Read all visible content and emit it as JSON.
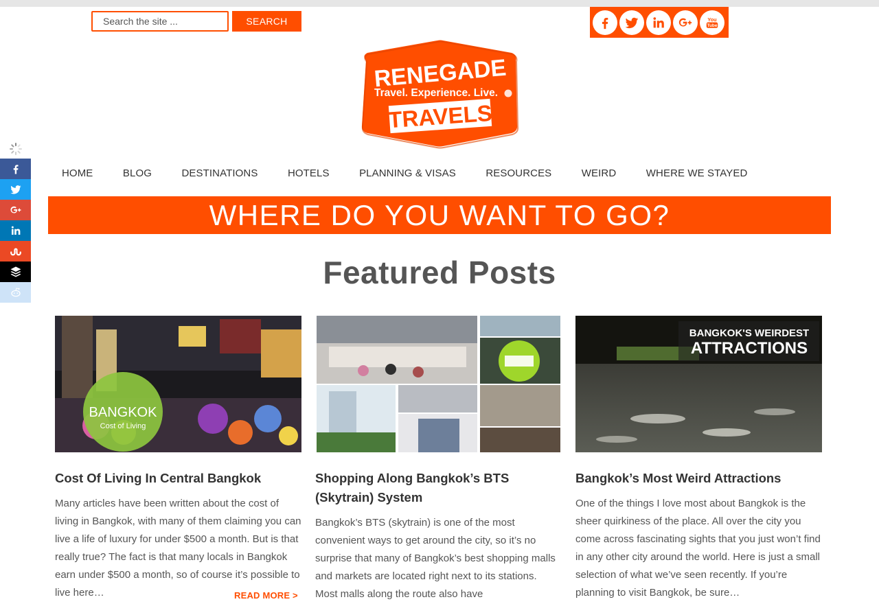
{
  "search": {
    "placeholder": "Search the site ...",
    "button_label": "SEARCH"
  },
  "social_top": {
    "icons": [
      "facebook-icon",
      "twitter-icon",
      "linkedin-icon",
      "google-plus-icon",
      "youtube-icon"
    ]
  },
  "logo": {
    "line1": "RENEGADE",
    "line2": "Travel. Experience. Live.",
    "line3": "TRAVELS"
  },
  "nav": {
    "items": [
      {
        "label": "HOME"
      },
      {
        "label": "BLOG"
      },
      {
        "label": "DESTINATIONS"
      },
      {
        "label": "HOTELS"
      },
      {
        "label": "PLANNING & VISAS"
      },
      {
        "label": "RESOURCES"
      },
      {
        "label": "WEIRD"
      },
      {
        "label": "WHERE WE STAYED"
      }
    ]
  },
  "banner": {
    "text": "WHERE DO YOU WANT TO GO?"
  },
  "featured": {
    "heading": "Featured Posts"
  },
  "share_bar": {
    "items": [
      "facebook-icon",
      "twitter-icon",
      "google-plus-icon",
      "linkedin-icon",
      "stumbleupon-icon",
      "buffer-icon",
      "reddit-icon"
    ]
  },
  "colors": {
    "accent": "#ff4e00",
    "facebook": "#3b5998",
    "twitter": "#1da1f2",
    "google_plus": "#dd4b39",
    "linkedin": "#0077b5",
    "stumbleupon": "#eb4924",
    "buffer": "#000000",
    "reddit": "#cee3f8"
  },
  "posts": [
    {
      "title": "Cost Of Living In Central Bangkok",
      "image_text_1": "BANGKOK",
      "image_text_2": "Cost of Living",
      "excerpt": "Many articles have been written about the cost of living in Bangkok, with many of them claiming you can live a life of luxury for under $500 a month. But is that really true? The fact is that many locals in Bangkok earn under $500 a month, so of course it’s possible to live here…",
      "read_more": "READ MORE >"
    },
    {
      "title": "Shopping Along Bangkok’s BTS (Skytrain) System",
      "excerpt": "Bangkok’s BTS (skytrain) is one of the most convenient ways to get around the city, so it’s no surprise that many of Bangkok’s best shopping malls and markets are located right next to its stations. Most malls along the route also have"
    },
    {
      "title": "Bangkok’s Most Weird Attractions",
      "image_text_1": "BANGKOK'S WEIRDEST",
      "image_text_2": "ATTRACTIONS",
      "excerpt": "One of the things I love most about Bangkok is the sheer quirkiness of the place. All over the city you come across fascinating sights that you just won’t find in any other city around the world. Here is just a small selection of what we’ve seen recently. If you’re planning to visit Bangkok, be sure…"
    }
  ]
}
